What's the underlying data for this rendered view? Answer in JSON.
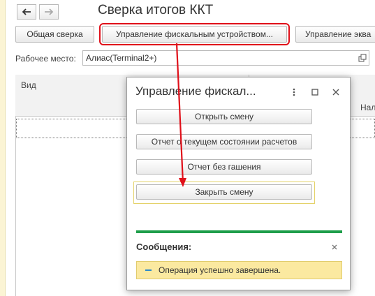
{
  "window": {
    "title": "Сверка итогов ККТ"
  },
  "nav": {
    "back_icon": "arrow-left-icon",
    "forward_icon": "arrow-right-icon"
  },
  "toolbar": {
    "buttons": [
      {
        "label": "Общая сверка"
      },
      {
        "label": "Управление фискальным устройством..."
      },
      {
        "label": "Управление эква"
      }
    ]
  },
  "workplace": {
    "label": "Рабочее место:",
    "value": "Алиас(Terminal2+)",
    "open_icon": "open-link-icon"
  },
  "table": {
    "columns": [
      {
        "label": "Вид"
      },
      {
        "label": "Нал"
      }
    ]
  },
  "dialog": {
    "title": "Управление фискал...",
    "menu_icon": "more-vertical-icon",
    "maximize_icon": "maximize-icon",
    "close_icon": "close-icon",
    "buttons": [
      {
        "label": "Открыть смену"
      },
      {
        "label": "Отчет о текущем состоянии расчетов"
      },
      {
        "label": "Отчет без гашения"
      },
      {
        "label": "Закрыть смену"
      }
    ],
    "progress": {
      "percent": 100,
      "color": "#1e9e4a"
    },
    "messages": {
      "title": "Сообщения:",
      "close_icon": "close-icon",
      "items": [
        {
          "text": "Операция успешно завершена."
        }
      ]
    }
  },
  "colors": {
    "highlight": "#e0101a",
    "message_bg": "#fbe9a0",
    "progress": "#1e9e4a"
  }
}
